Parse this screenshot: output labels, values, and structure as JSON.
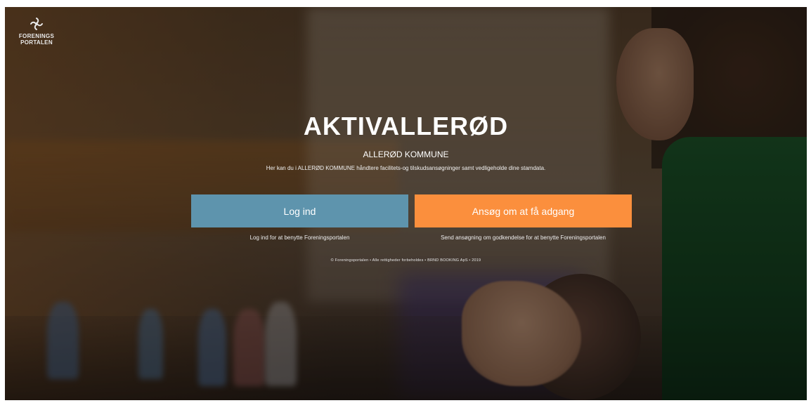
{
  "logo": {
    "line1": "FORENINGS",
    "line2": "PORTALEN"
  },
  "hero": {
    "title": "AKTIVALLERØD",
    "subtitle": "ALLERØD KOMMUNE",
    "intro": "Her kan du i ALLERØD KOMMUNE håndtere facilitets-og tilskudsansøgninger samt vedligeholde dine stamdata."
  },
  "actions": {
    "login_label": "Log ind",
    "login_hint": "Log ind for at benytte Foreningsportalen",
    "apply_label": "Ansøg om at få adgang",
    "apply_hint": "Send ansøgning om godkendelse for at benytte Foreningsportalen"
  },
  "footer": {
    "text": "© Foreningsportalen  •  Alle rettigheder forbeholdes  •  BRND BOOKING ApS  •  2019"
  },
  "colors": {
    "login_button": "#5e94ad",
    "apply_button": "#fb8f3d",
    "overlay": "rgba(0,0,0,0.42)"
  },
  "icons": {
    "logo": "foreningsportalen-logo-icon"
  }
}
